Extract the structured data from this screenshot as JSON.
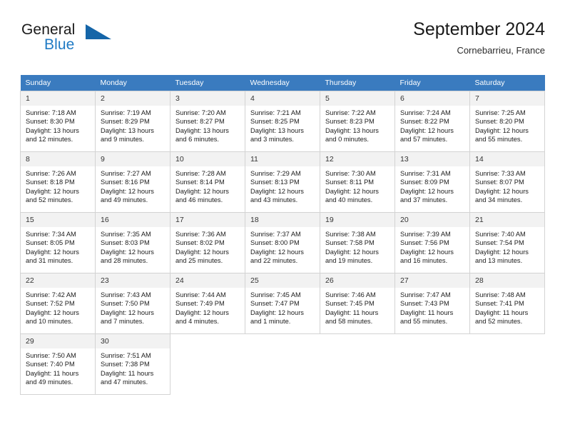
{
  "brand": {
    "name_part1": "General",
    "name_part2": "Blue",
    "logo_icon": "blue-flag-triangle-icon",
    "color_primary": "#1f7ac4",
    "color_text": "#1a1a1a"
  },
  "header": {
    "title": "September 2024",
    "subtitle": "Cornebarrieu, France"
  },
  "theme": {
    "header_row_bg": "#3a7bbf",
    "header_row_text": "#ffffff",
    "daynum_bg": "#f2f2f2",
    "cell_border": "#d3d3d3"
  },
  "weekdays": [
    "Sunday",
    "Monday",
    "Tuesday",
    "Wednesday",
    "Thursday",
    "Friday",
    "Saturday"
  ],
  "weeks": [
    [
      {
        "day": "1",
        "sunrise": "Sunrise: 7:18 AM",
        "sunset": "Sunset: 8:30 PM",
        "daylight": "Daylight: 13 hours and 12 minutes."
      },
      {
        "day": "2",
        "sunrise": "Sunrise: 7:19 AM",
        "sunset": "Sunset: 8:29 PM",
        "daylight": "Daylight: 13 hours and 9 minutes."
      },
      {
        "day": "3",
        "sunrise": "Sunrise: 7:20 AM",
        "sunset": "Sunset: 8:27 PM",
        "daylight": "Daylight: 13 hours and 6 minutes."
      },
      {
        "day": "4",
        "sunrise": "Sunrise: 7:21 AM",
        "sunset": "Sunset: 8:25 PM",
        "daylight": "Daylight: 13 hours and 3 minutes."
      },
      {
        "day": "5",
        "sunrise": "Sunrise: 7:22 AM",
        "sunset": "Sunset: 8:23 PM",
        "daylight": "Daylight: 13 hours and 0 minutes."
      },
      {
        "day": "6",
        "sunrise": "Sunrise: 7:24 AM",
        "sunset": "Sunset: 8:22 PM",
        "daylight": "Daylight: 12 hours and 57 minutes."
      },
      {
        "day": "7",
        "sunrise": "Sunrise: 7:25 AM",
        "sunset": "Sunset: 8:20 PM",
        "daylight": "Daylight: 12 hours and 55 minutes."
      }
    ],
    [
      {
        "day": "8",
        "sunrise": "Sunrise: 7:26 AM",
        "sunset": "Sunset: 8:18 PM",
        "daylight": "Daylight: 12 hours and 52 minutes."
      },
      {
        "day": "9",
        "sunrise": "Sunrise: 7:27 AM",
        "sunset": "Sunset: 8:16 PM",
        "daylight": "Daylight: 12 hours and 49 minutes."
      },
      {
        "day": "10",
        "sunrise": "Sunrise: 7:28 AM",
        "sunset": "Sunset: 8:14 PM",
        "daylight": "Daylight: 12 hours and 46 minutes."
      },
      {
        "day": "11",
        "sunrise": "Sunrise: 7:29 AM",
        "sunset": "Sunset: 8:13 PM",
        "daylight": "Daylight: 12 hours and 43 minutes."
      },
      {
        "day": "12",
        "sunrise": "Sunrise: 7:30 AM",
        "sunset": "Sunset: 8:11 PM",
        "daylight": "Daylight: 12 hours and 40 minutes."
      },
      {
        "day": "13",
        "sunrise": "Sunrise: 7:31 AM",
        "sunset": "Sunset: 8:09 PM",
        "daylight": "Daylight: 12 hours and 37 minutes."
      },
      {
        "day": "14",
        "sunrise": "Sunrise: 7:33 AM",
        "sunset": "Sunset: 8:07 PM",
        "daylight": "Daylight: 12 hours and 34 minutes."
      }
    ],
    [
      {
        "day": "15",
        "sunrise": "Sunrise: 7:34 AM",
        "sunset": "Sunset: 8:05 PM",
        "daylight": "Daylight: 12 hours and 31 minutes."
      },
      {
        "day": "16",
        "sunrise": "Sunrise: 7:35 AM",
        "sunset": "Sunset: 8:03 PM",
        "daylight": "Daylight: 12 hours and 28 minutes."
      },
      {
        "day": "17",
        "sunrise": "Sunrise: 7:36 AM",
        "sunset": "Sunset: 8:02 PM",
        "daylight": "Daylight: 12 hours and 25 minutes."
      },
      {
        "day": "18",
        "sunrise": "Sunrise: 7:37 AM",
        "sunset": "Sunset: 8:00 PM",
        "daylight": "Daylight: 12 hours and 22 minutes."
      },
      {
        "day": "19",
        "sunrise": "Sunrise: 7:38 AM",
        "sunset": "Sunset: 7:58 PM",
        "daylight": "Daylight: 12 hours and 19 minutes."
      },
      {
        "day": "20",
        "sunrise": "Sunrise: 7:39 AM",
        "sunset": "Sunset: 7:56 PM",
        "daylight": "Daylight: 12 hours and 16 minutes."
      },
      {
        "day": "21",
        "sunrise": "Sunrise: 7:40 AM",
        "sunset": "Sunset: 7:54 PM",
        "daylight": "Daylight: 12 hours and 13 minutes."
      }
    ],
    [
      {
        "day": "22",
        "sunrise": "Sunrise: 7:42 AM",
        "sunset": "Sunset: 7:52 PM",
        "daylight": "Daylight: 12 hours and 10 minutes."
      },
      {
        "day": "23",
        "sunrise": "Sunrise: 7:43 AM",
        "sunset": "Sunset: 7:50 PM",
        "daylight": "Daylight: 12 hours and 7 minutes."
      },
      {
        "day": "24",
        "sunrise": "Sunrise: 7:44 AM",
        "sunset": "Sunset: 7:49 PM",
        "daylight": "Daylight: 12 hours and 4 minutes."
      },
      {
        "day": "25",
        "sunrise": "Sunrise: 7:45 AM",
        "sunset": "Sunset: 7:47 PM",
        "daylight": "Daylight: 12 hours and 1 minute."
      },
      {
        "day": "26",
        "sunrise": "Sunrise: 7:46 AM",
        "sunset": "Sunset: 7:45 PM",
        "daylight": "Daylight: 11 hours and 58 minutes."
      },
      {
        "day": "27",
        "sunrise": "Sunrise: 7:47 AM",
        "sunset": "Sunset: 7:43 PM",
        "daylight": "Daylight: 11 hours and 55 minutes."
      },
      {
        "day": "28",
        "sunrise": "Sunrise: 7:48 AM",
        "sunset": "Sunset: 7:41 PM",
        "daylight": "Daylight: 11 hours and 52 minutes."
      }
    ],
    [
      {
        "day": "29",
        "sunrise": "Sunrise: 7:50 AM",
        "sunset": "Sunset: 7:40 PM",
        "daylight": "Daylight: 11 hours and 49 minutes."
      },
      {
        "day": "30",
        "sunrise": "Sunrise: 7:51 AM",
        "sunset": "Sunset: 7:38 PM",
        "daylight": "Daylight: 11 hours and 47 minutes."
      },
      null,
      null,
      null,
      null,
      null
    ]
  ]
}
